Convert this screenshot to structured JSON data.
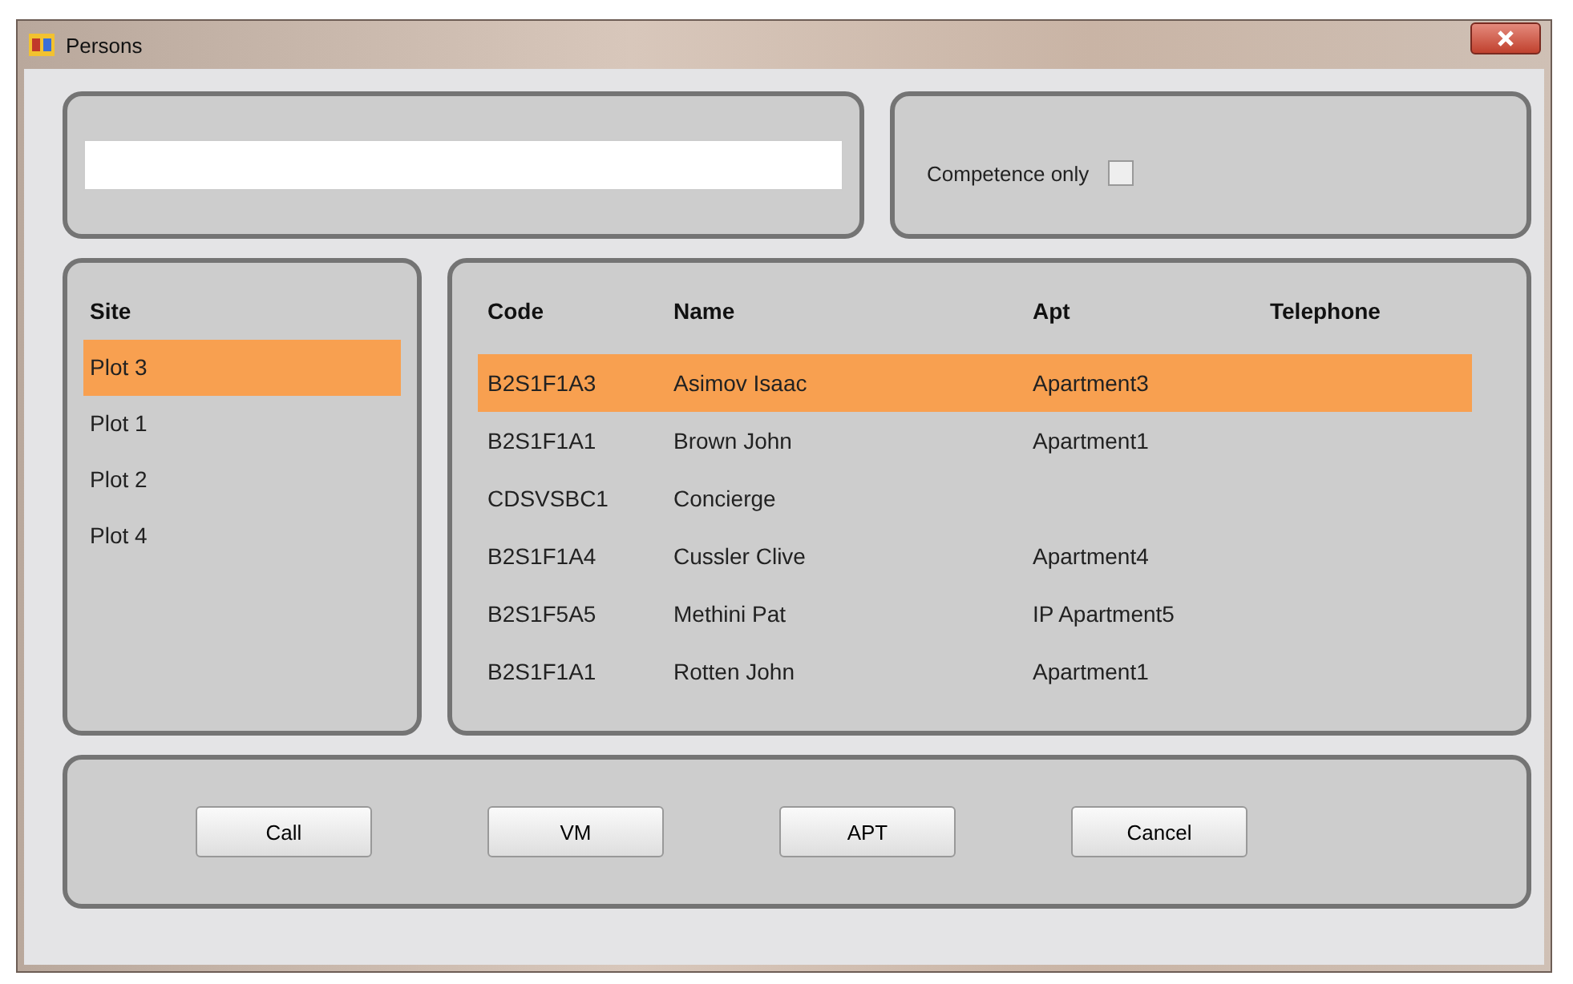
{
  "window": {
    "title": "Persons"
  },
  "competence_only": {
    "label": "Competence only",
    "checked": false
  },
  "sites": {
    "header": "Site",
    "items": [
      {
        "label": "Plot 3",
        "selected": true
      },
      {
        "label": "Plot 1",
        "selected": false
      },
      {
        "label": "Plot 2",
        "selected": false
      },
      {
        "label": "Plot 4",
        "selected": false
      }
    ]
  },
  "table": {
    "columns": [
      "Code",
      "Name",
      "Apt",
      "Telephone"
    ],
    "rows": [
      {
        "cells": [
          "B2S1F1A3",
          "Asimov Isaac",
          "Apartment3",
          ""
        ],
        "selected": true
      },
      {
        "cells": [
          "B2S1F1A1",
          "Brown John",
          "Apartment1",
          ""
        ],
        "selected": false
      },
      {
        "cells": [
          "CDSVSBC1",
          "Concierge",
          "",
          ""
        ],
        "selected": false
      },
      {
        "cells": [
          "B2S1F1A4",
          "Cussler Clive",
          "Apartment4",
          ""
        ],
        "selected": false
      },
      {
        "cells": [
          "B2S1F5A5",
          "Methini Pat",
          "IP Apartment5",
          ""
        ],
        "selected": false
      },
      {
        "cells": [
          "B2S1F1A1",
          "Rotten John",
          "Apartment1",
          ""
        ],
        "selected": false
      }
    ]
  },
  "buttons": [
    "Call",
    "VM",
    "APT",
    "Cancel"
  ]
}
